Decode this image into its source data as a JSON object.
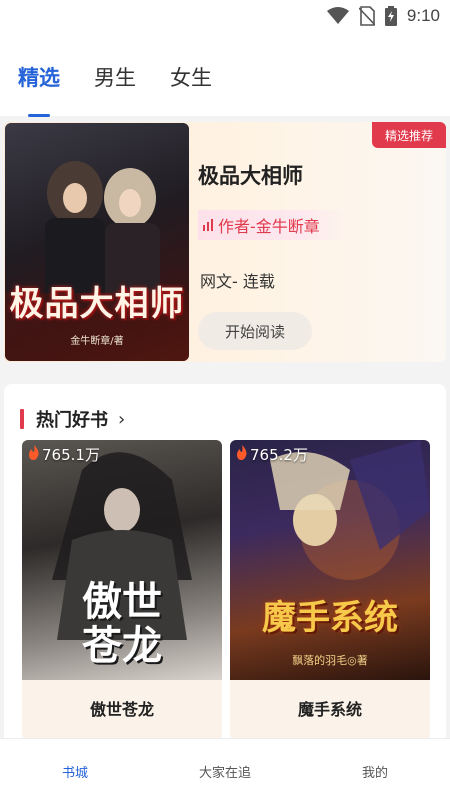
{
  "status_bar": {
    "time": "9:10",
    "icons": [
      "wifi-icon",
      "no-sim-icon",
      "battery-charging-icon"
    ]
  },
  "top_tabs": [
    {
      "label": "精选",
      "active": true
    },
    {
      "label": "男生",
      "active": false
    },
    {
      "label": "女生",
      "active": false
    }
  ],
  "featured": {
    "badge": "精选推荐",
    "title": "极品大相师",
    "author": "作者-金牛断章",
    "genre": "网文- 连载",
    "read_button": "开始阅读",
    "cover_title": "极品大相师",
    "cover_author": "金牛断章/著"
  },
  "hot_section": {
    "title": "热门好书",
    "chevron": "›",
    "books": [
      {
        "name": "傲世苍龙",
        "heat": "765.1万",
        "cover_title": "傲世\n苍龙"
      },
      {
        "name": "魔手系统",
        "heat": "765.2万",
        "cover_title": "魔手系统",
        "cover_author": "飘落的羽毛◎著"
      }
    ]
  },
  "bottom_nav": [
    {
      "label": "书城",
      "active": true
    },
    {
      "label": "大家在追",
      "active": false
    },
    {
      "label": "我的",
      "active": false
    }
  ],
  "colors": {
    "accent_blue": "#2563d8",
    "accent_red": "#e23a4d"
  }
}
